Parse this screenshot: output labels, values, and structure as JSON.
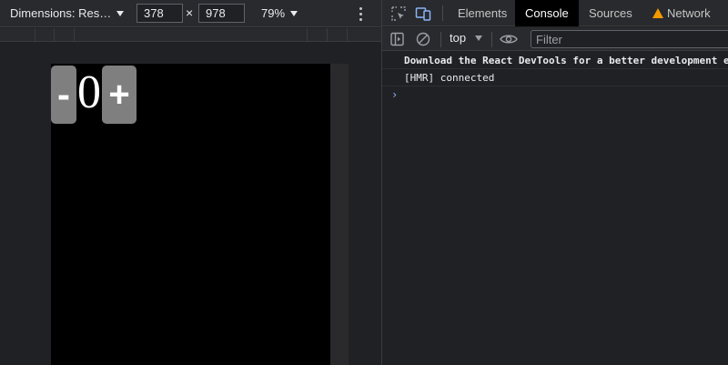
{
  "emulation": {
    "dimensions_label": "Dimensions: Res…",
    "width": "378",
    "height": "978",
    "times": "×",
    "zoom": "79%"
  },
  "app": {
    "minus_label": "-",
    "count": "0",
    "plus_label": "+"
  },
  "devtools": {
    "tabs": [
      {
        "label": "Elements"
      },
      {
        "label": "Console"
      },
      {
        "label": "Sources"
      },
      {
        "label": "Network"
      }
    ],
    "active_tab": "Console",
    "network_warning_icon": "warning-triangle-icon",
    "toolbar": {
      "context": "top",
      "filter_placeholder": "Filter"
    },
    "console_lines": [
      {
        "text": "Download the React DevTools for a better development experience"
      },
      {
        "text": "[HMR] connected"
      }
    ],
    "prompt": "›"
  },
  "colors": {
    "background": "#202124",
    "toolbar": "#292a2d",
    "viewport": "#000000",
    "button": "#7f7f7f",
    "warning": "#f29900",
    "prompt": "#8ab4f8"
  }
}
